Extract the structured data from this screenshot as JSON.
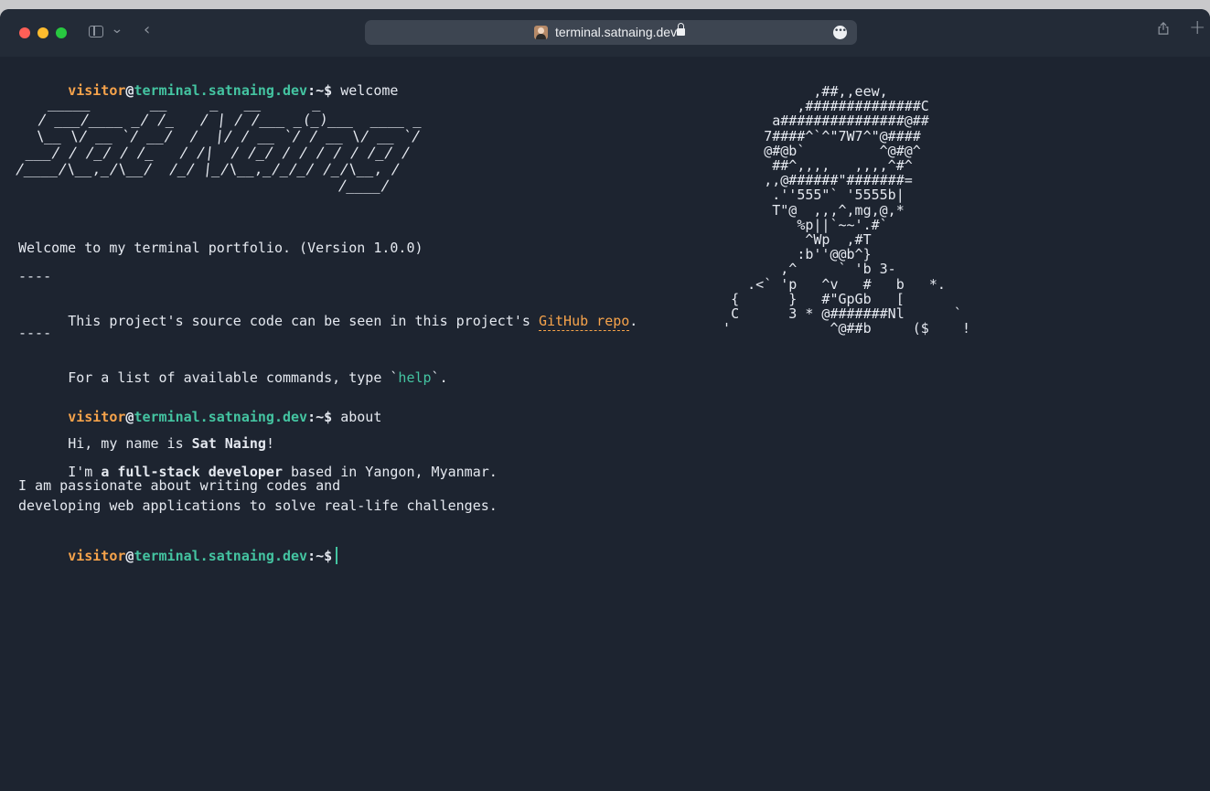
{
  "browser": {
    "url": "terminal.satnaing.dev"
  },
  "prompt": {
    "user": "visitor",
    "at": "@",
    "host": "terminal.satnaing.dev",
    "path": ":~$"
  },
  "commands": {
    "first": "welcome",
    "second": "about"
  },
  "welcome": {
    "banner_text": "Sat Naing",
    "banner_art": "   _____       __     _   __      _            \n  / ___/____ _/ /_   / | / /___ _(_)___  ____ _\n  \\__ \\/ __ `/ __/  /  |/ / __ `/ / __ \\/ __ `/\n ___/ / /_/ / /_   / /|  / /_/ / / / / / /_/ / \n/____/\\__,_/\\__/  /_/ |_/\\__,_/_/_/ /_/\\__, /  \n                                      /____/   ",
    "intro": "Welcome to my terminal portfolio. (Version 1.0.0)",
    "divider": "----",
    "source_prefix": "This project's source code can be seen in this project's ",
    "source_link": "GitHub repo",
    "source_suffix": ".",
    "help_prefix": "For a list of available commands, type `",
    "help_cmd": "help",
    "help_suffix": "`.",
    "ascii_portrait": "             ,##,,eew,\n           ,##############C\n        a###############@##\n       7####^`^\"7W7^\"@####\n       @#@b`         ^@#@^\n        ##^,,,,   ,,,,^#^\n       ,,@######\"#######=\n        .''555\"` '5555b|\n        T\"@  ,,,^,mg,@,*\n           %p||`~~'.#`\n            ^Wp  ,#T\n           :b''@@b^}\n         ,^     ` 'b 3-\n     .<` 'p   ^v   #   b   *.\n   {      }   #\"GpGb   [\n   C      3 * @#######Nl      `\n  '            ^@##b     ($    !"
  },
  "about": {
    "l1_prefix": "Hi, my name is ",
    "l1_name": "Sat Naing",
    "l1_suffix": "!",
    "l2_prefix": "I'm ",
    "l2_role": "a full-stack developer",
    "l2_suffix": " based in Yangon, Myanmar.",
    "l3": "I am passionate about writing codes and",
    "l4": "developing web applications to solve real-life challenges."
  },
  "colors": {
    "background": "#1d2430",
    "user": "#f6a34b",
    "host": "#44c4a1",
    "text": "#e5e9f0"
  }
}
